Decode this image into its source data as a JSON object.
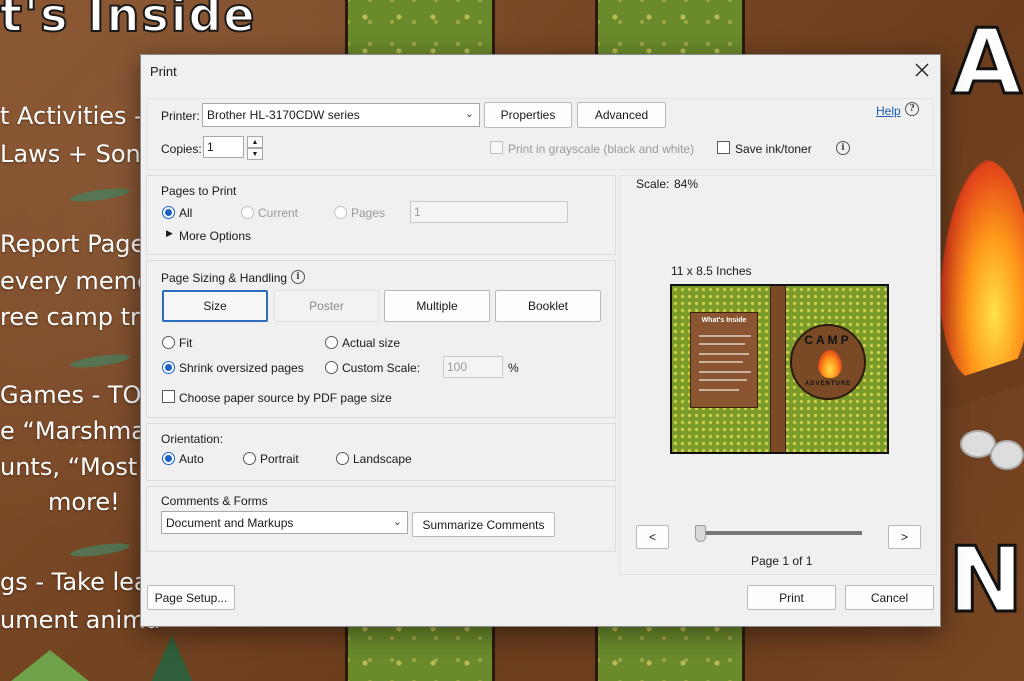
{
  "background": {
    "title_fragment": "t's Inside",
    "lines": [
      "t Activities -",
      "Laws + Song",
      "Report Page",
      "every memor",
      "ree camp tri",
      "Games - TO",
      "e “Marshmal",
      "unts, “Most",
      "more!",
      "gs - Take lea",
      "ument anima"
    ],
    "right_letter_top": "A",
    "right_letter_bottom": "N",
    "colors": {
      "leather": "#7a4a26",
      "green": "#6b8a2c"
    }
  },
  "dialog": {
    "title": "Print",
    "close_icon": "close-icon",
    "printer": {
      "label": "Printer:",
      "value": "Brother HL-3170CDW series",
      "properties_label": "Properties",
      "advanced_label": "Advanced",
      "help_label": "Help"
    },
    "copies": {
      "label": "Copies:",
      "value": "1"
    },
    "grayscale_label": "Print in grayscale (black and white)",
    "save_ink_label": "Save ink/toner",
    "pages_to_print": {
      "heading": "Pages to Print",
      "all_label": "All",
      "current_label": "Current",
      "pages_label": "Pages",
      "pages_value": "1",
      "more_options_label": "More Options"
    },
    "sizing": {
      "heading": "Page Sizing & Handling",
      "size_label": "Size",
      "poster_label": "Poster",
      "multiple_label": "Multiple",
      "booklet_label": "Booklet",
      "fit_label": "Fit",
      "actual_size_label": "Actual size",
      "shrink_label": "Shrink oversized pages",
      "custom_scale_label": "Custom Scale:",
      "custom_scale_value": "100",
      "percent_sign": "%",
      "paper_source_label": "Choose paper source by PDF page size"
    },
    "orientation": {
      "heading": "Orientation:",
      "auto_label": "Auto",
      "portrait_label": "Portrait",
      "landscape_label": "Landscape"
    },
    "comments": {
      "heading": "Comments & Forms",
      "value": "Document and Markups",
      "summarize_label": "Summarize Comments"
    },
    "preview": {
      "scale_label": "Scale:",
      "scale_value": "84%",
      "paper_size": "11 x 8.5 Inches",
      "page_info": "Page 1 of 1",
      "prev_label": "<",
      "next_label": ">",
      "thumb_title": "What's Inside",
      "badge_top": "CAMP",
      "badge_bottom": "ADVENTURE"
    },
    "page_setup_label": "Page Setup...",
    "print_label": "Print",
    "cancel_label": "Cancel"
  }
}
